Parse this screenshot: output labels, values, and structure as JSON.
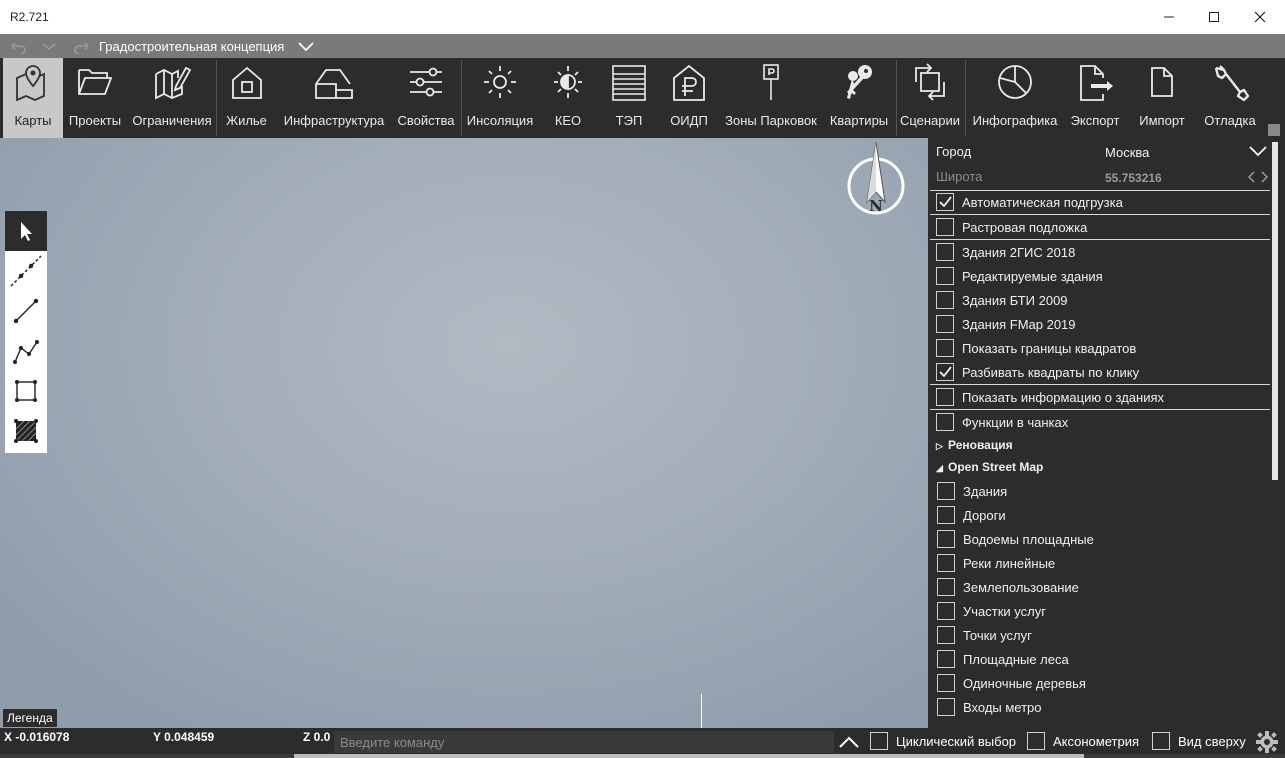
{
  "window": {
    "title": "R2.721"
  },
  "quickbar": {
    "project_title": "Градостроительная концепция"
  },
  "ribbon": {
    "items": [
      {
        "label": "Карты",
        "icon": "map-pin-icon",
        "active": true
      },
      {
        "label": "Проекты",
        "icon": "folder-open-icon"
      },
      {
        "label": "Ограничения",
        "icon": "map-edit-icon"
      },
      {
        "label": "Жилье",
        "icon": "house-icon"
      },
      {
        "label": "Инфраструктура",
        "icon": "building-icon"
      },
      {
        "label": "Свойства",
        "icon": "sliders-icon"
      },
      {
        "label": "Инсоляция",
        "icon": "sun-icon"
      },
      {
        "label": "КЕО",
        "icon": "half-sun-icon"
      },
      {
        "label": "ТЭП",
        "icon": "table-lines-icon"
      },
      {
        "label": "ОИДП",
        "icon": "ruble-house-icon"
      },
      {
        "label": "Зоны Парковок",
        "icon": "parking-sign-icon"
      },
      {
        "label": "Квартиры",
        "icon": "keys-icon"
      },
      {
        "label": "Сценарии",
        "icon": "refresh-square-icon"
      },
      {
        "label": "Инфографика",
        "icon": "pie-chart-icon"
      },
      {
        "label": "Экспорт",
        "icon": "file-export-icon"
      },
      {
        "label": "Импорт",
        "icon": "file-icon"
      },
      {
        "label": "Отладка",
        "icon": "wrench-icon"
      }
    ]
  },
  "map": {
    "compass_letter": "N",
    "legend_label": "Легенда"
  },
  "panel": {
    "city_label": "Город",
    "city_value": "Москва",
    "lat_label": "Широта",
    "lat_value": "55.753216",
    "checks": [
      {
        "label": "Автоматическая подгрузка",
        "checked": true
      },
      {
        "label": "Растровая подложка",
        "checked": false
      },
      {
        "label": "Здания 2ГИС 2018",
        "checked": false
      },
      {
        "label": "Редактируемые здания",
        "checked": false
      },
      {
        "label": "Здания БТИ 2009",
        "checked": false
      },
      {
        "label": "Здания FMap 2019",
        "checked": false
      },
      {
        "label": "Показать границы квадратов",
        "checked": false
      },
      {
        "label": "Разбивать квадраты по клику",
        "checked": true
      },
      {
        "label": "Показать информацию о зданиях",
        "checked": false
      },
      {
        "label": "Функции в чанках",
        "checked": false
      }
    ],
    "section_renovation": "Реновация",
    "section_osm": "Open Street Map",
    "osm_checks": [
      {
        "label": "Здания",
        "checked": false
      },
      {
        "label": "Дороги",
        "checked": false
      },
      {
        "label": "Водоемы площадные",
        "checked": false
      },
      {
        "label": "Реки линейные",
        "checked": false
      },
      {
        "label": "Землепользование",
        "checked": false
      },
      {
        "label": "Участки услуг",
        "checked": false
      },
      {
        "label": "Точки услуг",
        "checked": false
      },
      {
        "label": "Площадные леса",
        "checked": false
      },
      {
        "label": "Одиночные деревья",
        "checked": false
      },
      {
        "label": "Входы метро",
        "checked": false
      }
    ]
  },
  "status": {
    "x": "X -0.016078",
    "y": "Y 0.048459",
    "z": "Z 0.0",
    "command_placeholder": "Введите команду",
    "cyclic": "Циклический выбор",
    "axon": "Аксонометрия",
    "top": "Вид сверху"
  }
}
